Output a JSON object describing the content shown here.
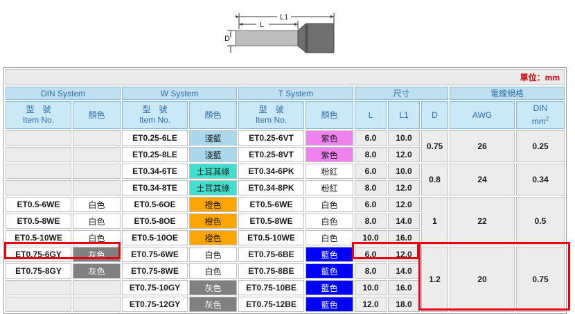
{
  "diagram": {
    "l1": "L1",
    "l": "L",
    "d": "D"
  },
  "unit_label": "單位：mm",
  "groups": {
    "din": "DIN System",
    "w": "W System",
    "t": "T System",
    "size": "尺寸",
    "wire": "電線規格"
  },
  "headers": {
    "item_cn": "型　號",
    "item_en": "Item No.",
    "color": "顏色",
    "L": "L",
    "L1": "L1",
    "D": "D",
    "AWG": "AWG",
    "DIN": "DIN",
    "mm2": "mm2"
  },
  "colors": {
    "light_blue": "#a8d8ea",
    "turquoise": "#40e0d0",
    "pink": "#ee82ee",
    "orange": "#ffa500",
    "gray": "#808080",
    "blue": "#0000ff",
    "white": "#ffffff",
    "highlight": "#e8000f"
  },
  "rows": [
    {
      "din_item": "",
      "din_color": "",
      "w_item": "ET0.25-6LE",
      "w_color": "淺藍",
      "w_bg": "#a8d8ea",
      "t_item": "ET0.25-6VT",
      "t_color": "紫色",
      "t_bg": "#ee82ee",
      "L": "6.0",
      "L1": "10.0"
    },
    {
      "din_item": "",
      "din_color": "",
      "w_item": "ET0.25-8LE",
      "w_color": "淺藍",
      "w_bg": "#a8d8ea",
      "t_item": "ET0.25-8VT",
      "t_color": "紫色",
      "t_bg": "#ee82ee",
      "L": "8.0",
      "L1": "12.0"
    },
    {
      "din_item": "",
      "din_color": "",
      "w_item": "ET0.34-6TE",
      "w_color": "土耳其綠",
      "w_bg": "#40e0d0",
      "t_item": "ET0.34-6PK",
      "t_color": "粉紅",
      "t_bg": "#ffffff",
      "L": "6.0",
      "L1": "10.0"
    },
    {
      "din_item": "",
      "din_color": "",
      "w_item": "ET0.34-8TE",
      "w_color": "土耳其綠",
      "w_bg": "#40e0d0",
      "t_item": "ET0.34-8PK",
      "t_color": "粉紅",
      "t_bg": "#ffffff",
      "L": "8.0",
      "L1": "12.0"
    },
    {
      "din_item": "ET0.5-6WE",
      "din_color": "白色",
      "din_bg": "#ffffff",
      "w_item": "ET0.5-6OE",
      "w_color": "橙色",
      "w_bg": "#ffa500",
      "t_item": "ET0.5-6WE",
      "t_color": "白色",
      "t_bg": "#ffffff",
      "L": "6.0",
      "L1": "12.0"
    },
    {
      "din_item": "ET0.5-8WE",
      "din_color": "白色",
      "din_bg": "#ffffff",
      "w_item": "ET0.5-8OE",
      "w_color": "橙色",
      "w_bg": "#ffa500",
      "t_item": "ET0.5-8WE",
      "t_color": "白色",
      "t_bg": "#ffffff",
      "L": "8.0",
      "L1": "14.0"
    },
    {
      "din_item": "ET0.5-10WE",
      "din_color": "白色",
      "din_bg": "#ffffff",
      "w_item": "ET0.5-10OE",
      "w_color": "橙色",
      "w_bg": "#ffa500",
      "t_item": "ET0.5-10WE",
      "t_color": "白色",
      "t_bg": "#ffffff",
      "L": "10.0",
      "L1": "16.0"
    },
    {
      "din_item": "ET0.75-6GY",
      "din_color": "灰色",
      "din_bg": "#808080",
      "w_item": "ET0.75-6WE",
      "w_color": "白色",
      "w_bg": "#ffffff",
      "t_item": "ET0.75-6BE",
      "t_color": "藍色",
      "t_bg": "#0000ff",
      "L": "6.0",
      "L1": "12.0"
    },
    {
      "din_item": "ET0.75-8GY",
      "din_color": "灰色",
      "din_bg": "#808080",
      "w_item": "ET0.75-8WE",
      "w_color": "白色",
      "w_bg": "#ffffff",
      "t_item": "ET0.75-8BE",
      "t_color": "藍色",
      "t_bg": "#0000ff",
      "L": "8.0",
      "L1": "14.0"
    },
    {
      "din_item": "",
      "din_color": "",
      "w_item": "ET0.75-10GY",
      "w_color": "灰色",
      "w_bg": "#808080",
      "t_item": "ET0.75-10BE",
      "t_color": "藍色",
      "t_bg": "#0000ff",
      "L": "10.0",
      "L1": "16.0"
    },
    {
      "din_item": "",
      "din_color": "",
      "w_item": "ET0.75-12GY",
      "w_color": "灰色",
      "w_bg": "#808080",
      "t_item": "ET0.75-12BE",
      "t_color": "藍色",
      "t_bg": "#0000ff",
      "L": "12.0",
      "L1": "18.0"
    }
  ],
  "merged": [
    {
      "start": 0,
      "span": 2,
      "D": "0.75",
      "AWG": "26",
      "DIN": "0.25"
    },
    {
      "start": 2,
      "span": 2,
      "D": "0.8",
      "AWG": "24",
      "DIN": "0.34"
    },
    {
      "start": 4,
      "span": 3,
      "D": "1",
      "AWG": "22",
      "DIN": "0.5"
    },
    {
      "start": 7,
      "span": 4,
      "D": "1.2",
      "AWG": "20",
      "DIN": "0.75"
    }
  ]
}
